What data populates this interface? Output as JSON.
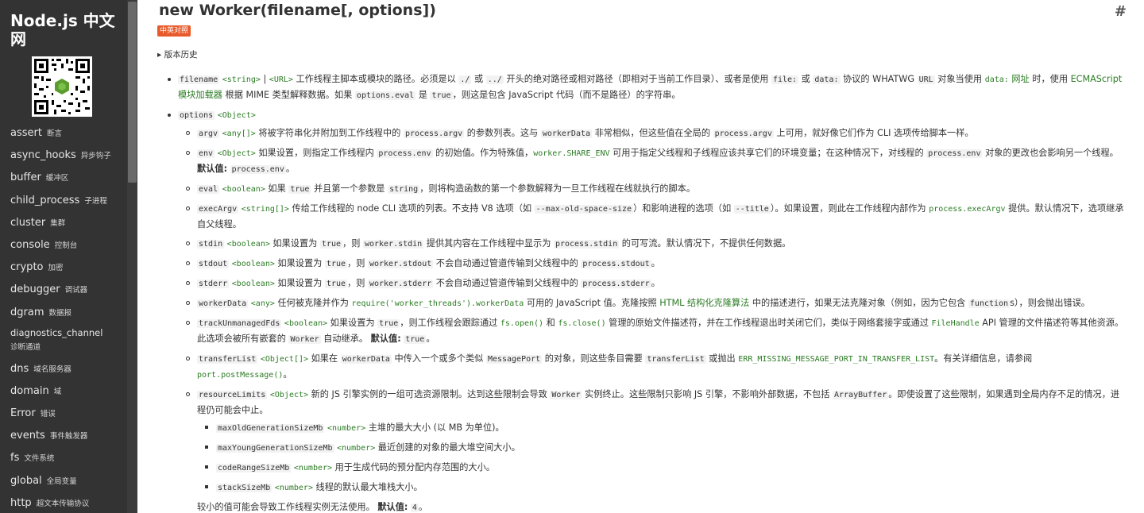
{
  "sidebar": {
    "logo": "Node.js 中文网",
    "nav": [
      {
        "en": "assert",
        "cn": "断言"
      },
      {
        "en": "async_hooks",
        "cn": "异步钩子"
      },
      {
        "en": "buffer",
        "cn": "缓冲区"
      },
      {
        "en": "child_process",
        "cn": "子进程"
      },
      {
        "en": "cluster",
        "cn": "集群"
      },
      {
        "en": "console",
        "cn": "控制台"
      },
      {
        "en": "crypto",
        "cn": "加密"
      },
      {
        "en": "debugger",
        "cn": "调试器"
      },
      {
        "en": "dgram",
        "cn": "数据报"
      },
      {
        "en": "diagnostics_channel",
        "cn": "诊断通道"
      },
      {
        "en": "dns",
        "cn": "域名服务器"
      },
      {
        "en": "domain",
        "cn": "域"
      },
      {
        "en": "Error",
        "cn": "错误"
      },
      {
        "en": "events",
        "cn": "事件触发器"
      },
      {
        "en": "fs",
        "cn": "文件系统"
      },
      {
        "en": "global",
        "cn": "全局变量"
      },
      {
        "en": "http",
        "cn": "超文本传输协议"
      }
    ]
  },
  "header": {
    "title": "new Worker(filename[, options])",
    "hash": "#",
    "badge": "中英对照",
    "history": "▸ 版本历史"
  },
  "filename": {
    "name": "filename",
    "type1": "<string>",
    "sep": " | ",
    "type2": "<URL>",
    "t1": " 工作线程主脚本或模块的路径。必须是以 ",
    "c1": "./",
    "t2": " 或 ",
    "c2": "../",
    "t3": " 开头的绝对路径或相对路径（即相对于当前工作目录）、或者是使用 ",
    "c3": "file:",
    "t4": " 或 ",
    "c4": "data:",
    "t5": " 协议的 WHATWG ",
    "c5": "URL",
    "t6": " 对象当使用 ",
    "l1": "data:",
    "l1b": " 网址",
    "t7": " 时，使用 ",
    "l2": "ECMAScript 模块加载器",
    "t8": " 根据 MIME 类型解释数据。如果 ",
    "c6": "options.eval",
    "t9": " 是 ",
    "c7": "true",
    "t10": "，则这是包含 JavaScript 代码（而不是路径）的字符串。"
  },
  "options": {
    "name": "options",
    "type": "<Object>",
    "argv": {
      "name": "argv",
      "type": "<any[]>",
      "t1": " 将被字符串化并附加到工作线程中的 ",
      "c1": "process.argv",
      "t2": " 的参数列表。这与 ",
      "c2": "workerData",
      "t3": " 非常相似，但这些值在全局的 ",
      "c3": "process.argv",
      "t4": " 上可用，就好像它们作为 CLI 选项传给脚本一样。"
    },
    "env": {
      "name": "env",
      "type": "<Object>",
      "t1": " 如果设置，则指定工作线程内 ",
      "c1": "process.env",
      "t2": " 的初始值。作为特殊值，",
      "l1": "worker.SHARE_ENV",
      "t3": " 可用于指定父线程和子线程应该共享它们的环境变量；在这种情况下，对线程的 ",
      "c2": "process.env",
      "t4": " 对象的更改也会影响另一个线程。 ",
      "b": "默认值:",
      "c3": "process.env",
      "t5": "。"
    },
    "eval": {
      "name": "eval",
      "type": "<boolean>",
      "t1": " 如果 ",
      "c1": "true",
      "t2": " 并且第一个参数是 ",
      "c2": "string",
      "t3": "，则将构造函数的第一个参数解释为一旦工作线程在线就执行的脚本。"
    },
    "execArgv": {
      "name": "execArgv",
      "type": "<string[]>",
      "t1": " 传给工作线程的 node CLI 选项的列表。不支持 V8 选项（如 ",
      "c1": "--max-old-space-size",
      "t2": "）和影响进程的选项（如 ",
      "c2": "--title",
      "t3": "）。如果设置，则此在工作线程内部作为 ",
      "l1": "process.execArgv",
      "t4": " 提供。默认情况下，选项继承自父线程。"
    },
    "stdin": {
      "name": "stdin",
      "type": "<boolean>",
      "t1": " 如果设置为 ",
      "c1": "true",
      "t2": "，则 ",
      "c2": "worker.stdin",
      "t3": " 提供其内容在工作线程中显示为 ",
      "c3": "process.stdin",
      "t4": " 的可写流。默认情况下，不提供任何数据。"
    },
    "stdout": {
      "name": "stdout",
      "type": "<boolean>",
      "t1": " 如果设置为 ",
      "c1": "true",
      "t2": "，则 ",
      "c2": "worker.stdout",
      "t3": " 不会自动通过管道传输到父线程中的 ",
      "c3": "process.stdout",
      "t4": "。"
    },
    "stderr": {
      "name": "stderr",
      "type": "<boolean>",
      "t1": " 如果设置为 ",
      "c1": "true",
      "t2": "，则 ",
      "c2": "worker.stderr",
      "t3": " 不会自动通过管道传输到父线程中的 ",
      "c3": "process.stderr",
      "t4": "。"
    },
    "workerData": {
      "name": "workerData",
      "type": "<any>",
      "t1": " 任何被克隆并作为 ",
      "l1": "require('worker_threads').workerData",
      "t2": " 可用的 JavaScript 值。克隆按照 ",
      "l2": "HTML 结构化克隆算法",
      "t3": " 中的描述进行，如果无法克隆对象（例如，因为它包含 ",
      "c1": "function",
      "t4": "s），则会抛出错误。"
    },
    "trackUnmanagedFds": {
      "name": "trackUnmanagedFds",
      "type": "<boolean>",
      "t1": " 如果设置为 ",
      "c1": "true",
      "t2": "，则工作线程会跟踪通过 ",
      "l1": "fs.open()",
      "t3": " 和 ",
      "l2": "fs.close()",
      "t4": " 管理的原始文件描述符，并在工作线程退出时关闭它们，类似于网络套接字或通过 ",
      "l3": "FileHandle",
      "t5": " API 管理的文件描述符等其他资源。此选项会被所有嵌套的 ",
      "c2": "Worker",
      "t6": " 自动继承。 ",
      "b": "默认值:",
      "c3": "true",
      "t7": "。"
    },
    "transferList": {
      "name": "transferList",
      "type": "<Object[]>",
      "t1": " 如果在 ",
      "c1": "workerData",
      "t2": " 中传入一个或多个类似 ",
      "c2": "MessagePort",
      "t3": " 的对象，则这些条目需要 ",
      "c3": "transferList",
      "t4": " 或抛出 ",
      "l1": "ERR_MISSING_MESSAGE_PORT_IN_TRANSFER_LIST",
      "t5": "。有关详细信息，请参阅 ",
      "l2": "port.postMessage()",
      "t6": "。"
    },
    "resourceLimits": {
      "name": "resourceLimits",
      "type": "<Object>",
      "t1": " 新的 JS 引擎实例的一组可选资源限制。达到这些限制会导致 ",
      "c1": "Worker",
      "t2": " 实例终止。这些限制只影响 JS 引擎，不影响外部数据，不包括 ",
      "c2": "ArrayBuffer",
      "t3": "。即使设置了这些限制，如果遇到全局内存不足的情况，进程仍可能会中止。",
      "items": [
        {
          "name": "maxOldGenerationSizeMb",
          "type": "<number>",
          "desc": " 主堆的最大大小 (以 MB 为单位)。"
        },
        {
          "name": "maxYoungGenerationSizeMb",
          "type": "<number>",
          "desc": " 最近创建的对象的最大堆空间大小。"
        },
        {
          "name": "codeRangeSizeMb",
          "type": "<number>",
          "desc": " 用于生成代码的预分配内存范围的大小。"
        },
        {
          "name": "stackSizeMb",
          "type": "<number>",
          "desc": " 线程的默认最大堆栈大小。"
        }
      ],
      "after1": "较小的值可能会导致工作线程实例无法使用。 ",
      "afterBold": "默认值:",
      "afterCode": "4",
      "after2": "。"
    }
  }
}
